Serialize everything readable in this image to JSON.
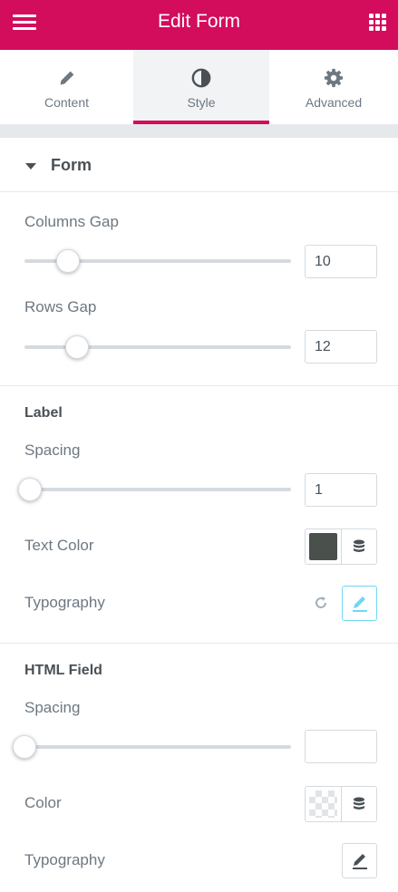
{
  "header": {
    "title": "Edit Form",
    "menu_icon": "hamburger-icon",
    "apps_icon": "grid-icon",
    "bg_color": "#d30c5c"
  },
  "tabs": [
    {
      "label": "Content",
      "icon": "pencil-icon",
      "active": false
    },
    {
      "label": "Style",
      "icon": "contrast-icon",
      "active": true
    },
    {
      "label": "Advanced",
      "icon": "gear-icon",
      "active": false
    }
  ],
  "form_section": {
    "title": "Form",
    "columns_gap": {
      "label": "Columns Gap",
      "value": "10",
      "slider_fraction": 0.17
    },
    "rows_gap": {
      "label": "Rows Gap",
      "value": "12",
      "slider_fraction": 0.2
    }
  },
  "label_section": {
    "title": "Label",
    "spacing": {
      "label": "Spacing",
      "value": "1",
      "slider_fraction": 0.02
    },
    "text_color": {
      "label": "Text Color",
      "color": "#4a504c"
    },
    "typography": {
      "label": "Typography"
    }
  },
  "html_field_section": {
    "title": "HTML Field",
    "spacing": {
      "label": "Spacing",
      "value": "",
      "slider_fraction": 0.0
    },
    "color": {
      "label": "Color",
      "color": ""
    },
    "typography": {
      "label": "Typography"
    }
  },
  "colors": {
    "accent": "#d30c5c",
    "active_edit": "#71d7f7",
    "text": "#6d7882",
    "heading": "#495157"
  }
}
